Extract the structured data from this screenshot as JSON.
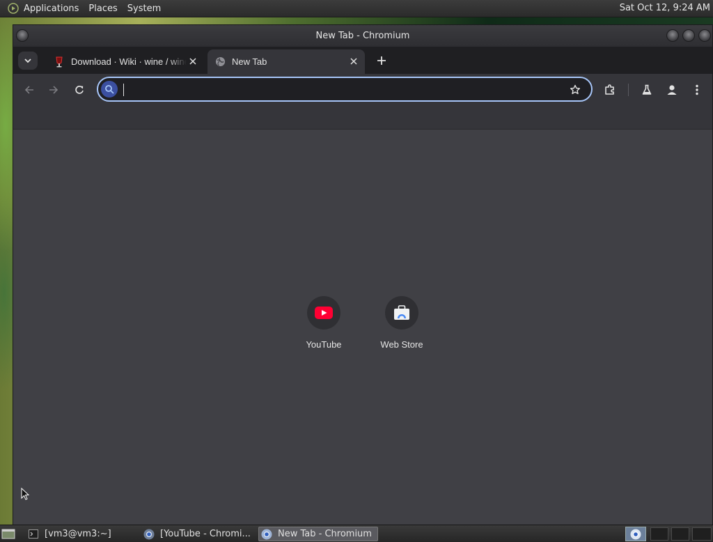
{
  "top_panel": {
    "menus": [
      "Applications",
      "Places",
      "System"
    ],
    "clock": "Sat Oct 12,  9:24 AM"
  },
  "window": {
    "title": "New Tab - Chromium"
  },
  "tabs": [
    {
      "title": "Download · Wiki · wine / wine",
      "favicon": "wine-icon",
      "active": false
    },
    {
      "title": "New Tab",
      "favicon": "globe-icon",
      "active": true
    }
  ],
  "toolbar": {
    "omnibox_value": "",
    "omnibox_placeholder": ""
  },
  "shortcuts": [
    {
      "label": "YouTube",
      "icon": "youtube-icon"
    },
    {
      "label": "Web Store",
      "icon": "web-store-icon"
    }
  ],
  "taskbar": {
    "tasks": [
      {
        "label": "[vm3@vm3:~]",
        "icon": "terminal-icon"
      },
      {
        "label": "[YouTube - Chromi...",
        "icon": "chromium-icon"
      },
      {
        "label": "New Tab - Chromium",
        "icon": "chromium-icon",
        "active": true
      }
    ]
  },
  "colors": {
    "accent": "#a8c7fa",
    "youtube_red": "#ff0033",
    "content_bg": "#404045"
  }
}
